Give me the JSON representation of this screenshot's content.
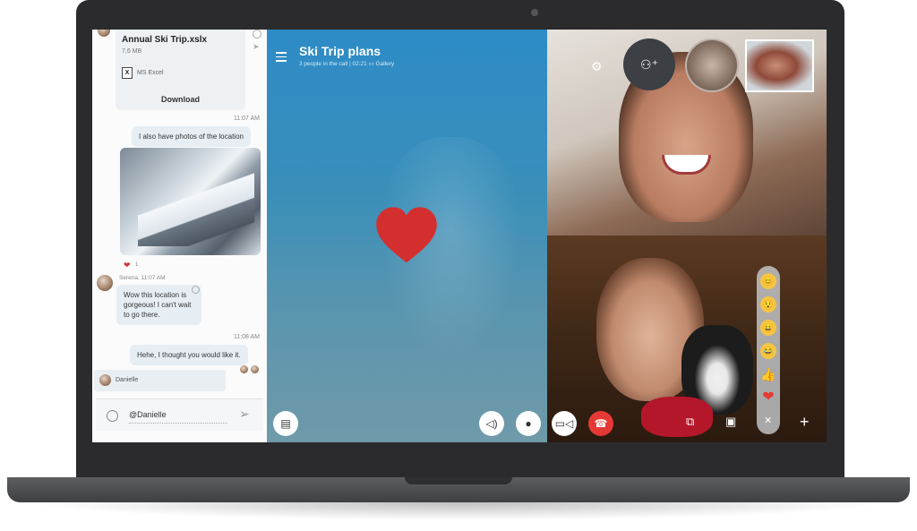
{
  "chat": {
    "file": {
      "name": "Annual Ski Trip.xslx",
      "size": "7,6 MB",
      "icon": "X",
      "app": "MS Excel",
      "download": "Download"
    },
    "messages": [
      {
        "time": "11:07 AM",
        "text": "I also have photos of the location"
      },
      {
        "reaction": "❤",
        "reaction_count": "1"
      },
      {
        "sender": "Serena, 11:07 AM",
        "text": "Wow this location is gorgeous! I can't wait to go there."
      },
      {
        "time": "11:08 AM",
        "text": "Hehe, I thought you would like it."
      }
    ],
    "mention_suggestion": "Danielle",
    "composer_value": "@Danielle"
  },
  "call": {
    "title": "Ski Trip plans",
    "subtitle": "3 people in the call | 02:21",
    "gallery": "Gallery",
    "icons": {
      "menu": "menu-icon",
      "chat": "chat-icon",
      "speaker": "speaker-icon",
      "mic": "microphone-icon",
      "video": "video-icon",
      "end": "end-call-icon",
      "settings": "gear-icon",
      "add_person": "add-person-icon"
    }
  },
  "reactions": [
    "😊",
    "😯",
    "😄",
    "😂",
    "👍",
    "❤"
  ],
  "colors": {
    "accent": "#2d8bc6",
    "end_call": "#e53935",
    "heart": "#d32f2f"
  }
}
